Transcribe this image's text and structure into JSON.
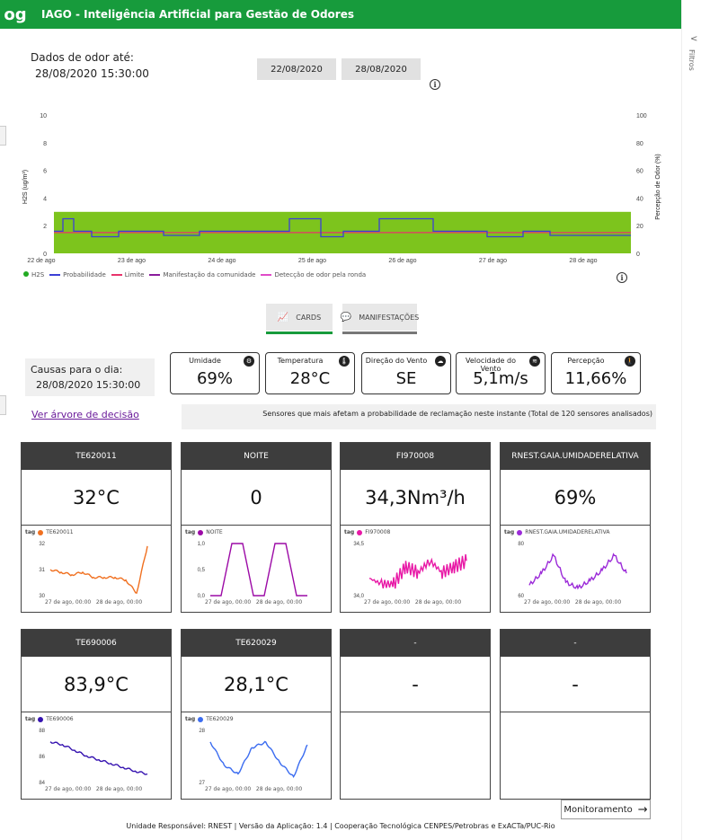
{
  "app": {
    "logo": "og",
    "title": "IAGO - Inteligência Artificial para Gestão de Odores"
  },
  "rail": {
    "chevron": "<",
    "filter_label": "Filtros"
  },
  "header": {
    "data_label": "Dados de odor até:",
    "data_value": "28/08/2020 15:30:00",
    "date_from": "22/08/2020",
    "date_to": "28/08/2020"
  },
  "colors": {
    "accent": "#179b3c",
    "band": "#7dc41d",
    "h2s": "#22aa22",
    "prob": "#3b3fd6",
    "limite": "#e8336b",
    "manif": "#8a1c9c",
    "deteccao": "#e04bc8"
  },
  "main_chart": {
    "ylabel_left": "H2S (ug/m³)",
    "ylabel_right": "Percepção de Odor (%)",
    "left_ticks": [
      "10",
      "8",
      "6",
      "4",
      "2",
      "0"
    ],
    "right_ticks": [
      "100",
      "80",
      "60",
      "40",
      "20",
      "0"
    ],
    "x_ticks": [
      "22 de ago",
      "23 de ago",
      "24 de ago",
      "25 de ago",
      "26 de ago",
      "27 de ago",
      "28 de ago"
    ],
    "legend": [
      "H2S",
      "Probabilidade",
      "Limite",
      "Manifestação da comunidade",
      "Detecção de odor pela ronda"
    ]
  },
  "chart_data": [
    {
      "type": "line",
      "title": "",
      "ylabel": "H2S (ug/m³)",
      "y2label": "Percepção de Odor (%)",
      "ylim": [
        0,
        10
      ],
      "y2lim": [
        0,
        100
      ],
      "x": [
        "22 de ago",
        "23 de ago",
        "24 de ago",
        "25 de ago",
        "26 de ago",
        "27 de ago",
        "28 de ago"
      ],
      "series": [
        {
          "name": "H2S",
          "band": [
            0,
            3
          ]
        },
        {
          "name": "Probabilidade",
          "values_approx": [
            1.6,
            2.5,
            1.6,
            1.3,
            1.2,
            1.6,
            2.5,
            1.2,
            2.5,
            1.2,
            1.6,
            1.3,
            1.6,
            1.2
          ]
        },
        {
          "name": "Limite",
          "value": 1.5
        }
      ]
    },
    {
      "type": "line",
      "series": [
        {
          "name": "TE620011",
          "values": [
            31.0,
            30.9,
            30.8,
            30.9,
            30.7,
            30.7,
            30.7,
            30.6,
            30.1,
            31.9
          ]
        }
      ],
      "ylim": [
        30,
        32
      ]
    },
    {
      "type": "line",
      "series": [
        {
          "name": "NOITE",
          "values": [
            0,
            0,
            1,
            1,
            0,
            0,
            1,
            1,
            0,
            0
          ]
        }
      ],
      "ylim": [
        0,
        1
      ]
    },
    {
      "type": "line",
      "series": [
        {
          "name": "FI970008",
          "values": [
            34.1,
            34.0,
            34.0,
            34.3,
            34.2,
            34.4,
            34.2,
            34.3,
            34.4
          ]
        }
      ],
      "ylim": [
        33.8,
        34.7
      ]
    },
    {
      "type": "line",
      "series": [
        {
          "name": "RNEST.GAIA.UMIDADERELATIVA",
          "values": [
            62,
            70,
            82,
            64,
            60,
            65,
            72,
            82,
            70
          ]
        }
      ],
      "ylim": [
        55,
        90
      ]
    },
    {
      "type": "line",
      "series": [
        {
          "name": "TE690006",
          "values": [
            87.3,
            87,
            86.4,
            85.8,
            85.4,
            85,
            84.6,
            84.2,
            83.9
          ]
        }
      ],
      "ylim": [
        83,
        88.5
      ]
    },
    {
      "type": "line",
      "series": [
        {
          "name": "TE620029",
          "values": [
            28.2,
            27.4,
            27.1,
            28.0,
            28.2,
            27.5,
            27.0,
            28.1
          ]
        }
      ],
      "ylim": [
        26.8,
        28.6
      ]
    }
  ],
  "nav": {
    "cards": "CARDS",
    "manifestacoes": "MANIFESTAÇÕES"
  },
  "causas": {
    "label": "Causas para o dia:",
    "value": "28/08/2020 15:30:00"
  },
  "kpis": [
    {
      "title": "Umidade",
      "value": "69%"
    },
    {
      "title": "Temperatura",
      "value": "28°C"
    },
    {
      "title": "Direção do Vento",
      "value": "SE"
    },
    {
      "title": "Velocidade do Vento",
      "value": "5,1m/s"
    },
    {
      "title": "Percepção",
      "value": "11,66%"
    }
  ],
  "arvore_link": "Ver árvore de decisão",
  "sensores_text": "Sensores que mais afetam a probabilidade de reclamação neste instante (Total de 120 sensores analisados)",
  "cards": [
    {
      "title": "TE620011",
      "value": "32°C",
      "tag": "TE620011",
      "color": "#f07020",
      "yticks": [
        "32",
        "31",
        "30"
      ]
    },
    {
      "title": "NOITE",
      "value": "0",
      "tag": "NOITE",
      "color": "#9c0aa6",
      "yticks": [
        "1,0",
        "0,5",
        "0,0"
      ]
    },
    {
      "title": "FI970008",
      "value": "34,3Nm³/h",
      "tag": "FI970008",
      "color": "#e818a6",
      "yticks": [
        "34,5",
        "34,0"
      ]
    },
    {
      "title": "RNEST.GAIA.UMIDADERELATIVA",
      "value": "69%",
      "tag": "RNEST.GAIA.UMIDADERELATIVA",
      "color": "#9b2ad8",
      "yticks": [
        "80",
        "60"
      ]
    },
    {
      "title": "TE690006",
      "value": "83,9°C",
      "tag": "TE690006",
      "color": "#3512b0",
      "yticks": [
        "88",
        "86",
        "84"
      ]
    },
    {
      "title": "TE620029",
      "value": "28,1°C",
      "tag": "TE620029",
      "color": "#3b6cf0",
      "yticks": [
        "28",
        "27"
      ]
    },
    {
      "title": "-",
      "value": "-"
    },
    {
      "title": "-",
      "value": "-"
    }
  ],
  "mini_x": "27 de ago, 00:00   28 de ago, 00:00",
  "tag_label": "tag",
  "monitoramento": "Monitoramento",
  "footer": "Unidade Responsável: RNEST | Versão da Aplicação: 1.4 | Cooperação Tecnológica CENPES/Petrobras e ExACTa/PUC-Rio"
}
